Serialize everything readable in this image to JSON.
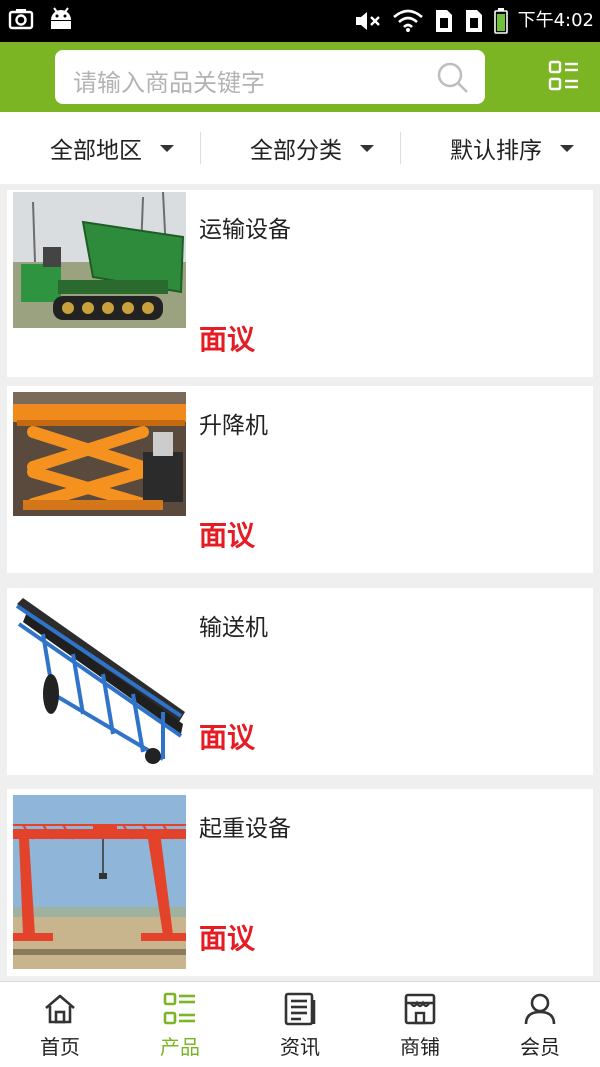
{
  "status_bar": {
    "time": "下午4:02",
    "icons": [
      "camera-icon",
      "android-icon",
      "mute-icon",
      "wifi-icon",
      "sim1-icon",
      "sim2-icon",
      "battery-icon"
    ]
  },
  "header": {
    "search_placeholder": "请输入商品关键字",
    "search_icon": "search-icon",
    "menu_icon": "grid-menu-icon",
    "accent_color": "#7cb524"
  },
  "filters": [
    {
      "label": "全部地区"
    },
    {
      "label": "全部分类"
    },
    {
      "label": "默认排序"
    }
  ],
  "products": [
    {
      "name": "运输设备",
      "price": "面议",
      "image": "crawler-dump-truck"
    },
    {
      "name": "升降机",
      "price": "面议",
      "image": "scissor-lift"
    },
    {
      "name": "输送机",
      "price": "面议",
      "image": "belt-conveyor"
    },
    {
      "name": "起重设备",
      "price": "面议",
      "image": "gantry-crane"
    }
  ],
  "price_color": "#e51c23",
  "tabs": [
    {
      "label": "首页",
      "icon": "home-icon",
      "active": false
    },
    {
      "label": "产品",
      "icon": "list-icon",
      "active": true
    },
    {
      "label": "资讯",
      "icon": "news-icon",
      "active": false
    },
    {
      "label": "商铺",
      "icon": "shop-icon",
      "active": false
    },
    {
      "label": "会员",
      "icon": "user-icon",
      "active": false
    }
  ]
}
